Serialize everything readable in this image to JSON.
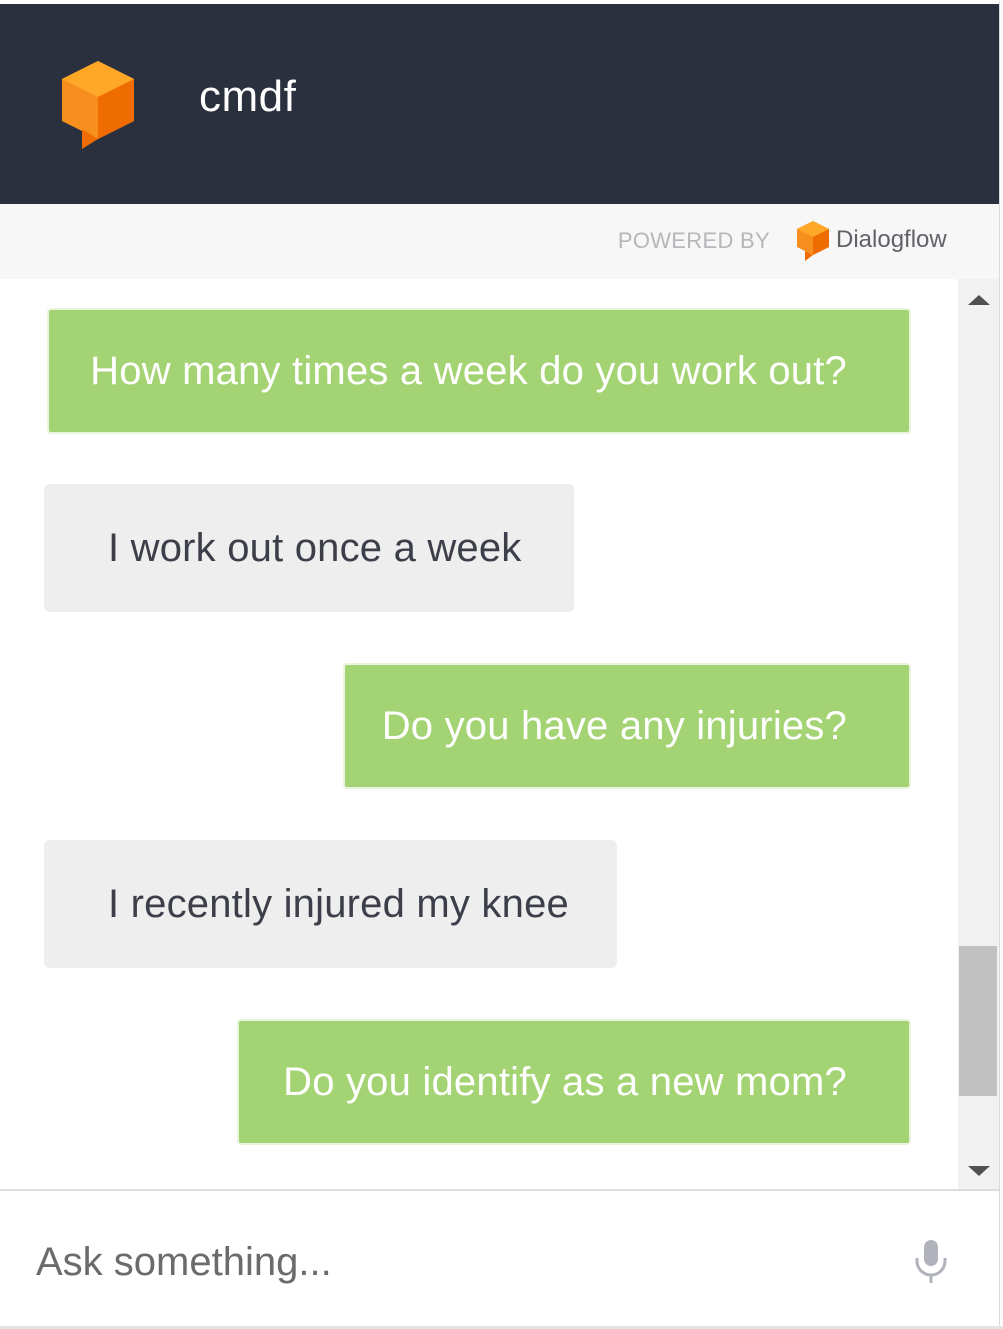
{
  "header": {
    "title": "cmdf",
    "logo_icon": "dialogflow-agent-icon"
  },
  "powered_by": {
    "label": "POWERED BY",
    "brand": "Dialogflow"
  },
  "messages": [
    {
      "sender": "bot",
      "text": "How many times a week do you work out?"
    },
    {
      "sender": "user",
      "text": "I work out once a week"
    },
    {
      "sender": "bot",
      "text": "Do you have any injuries?"
    },
    {
      "sender": "user",
      "text": "I recently injured my knee"
    },
    {
      "sender": "bot",
      "text": "Do you identify as a new mom?"
    }
  ],
  "input": {
    "placeholder": "Ask something...",
    "value": ""
  },
  "colors": {
    "header_bg": "#2b303e",
    "bot_bubble": "#a4d374",
    "user_bubble": "#eeeeee",
    "accent_orange": "#f78f1e"
  }
}
